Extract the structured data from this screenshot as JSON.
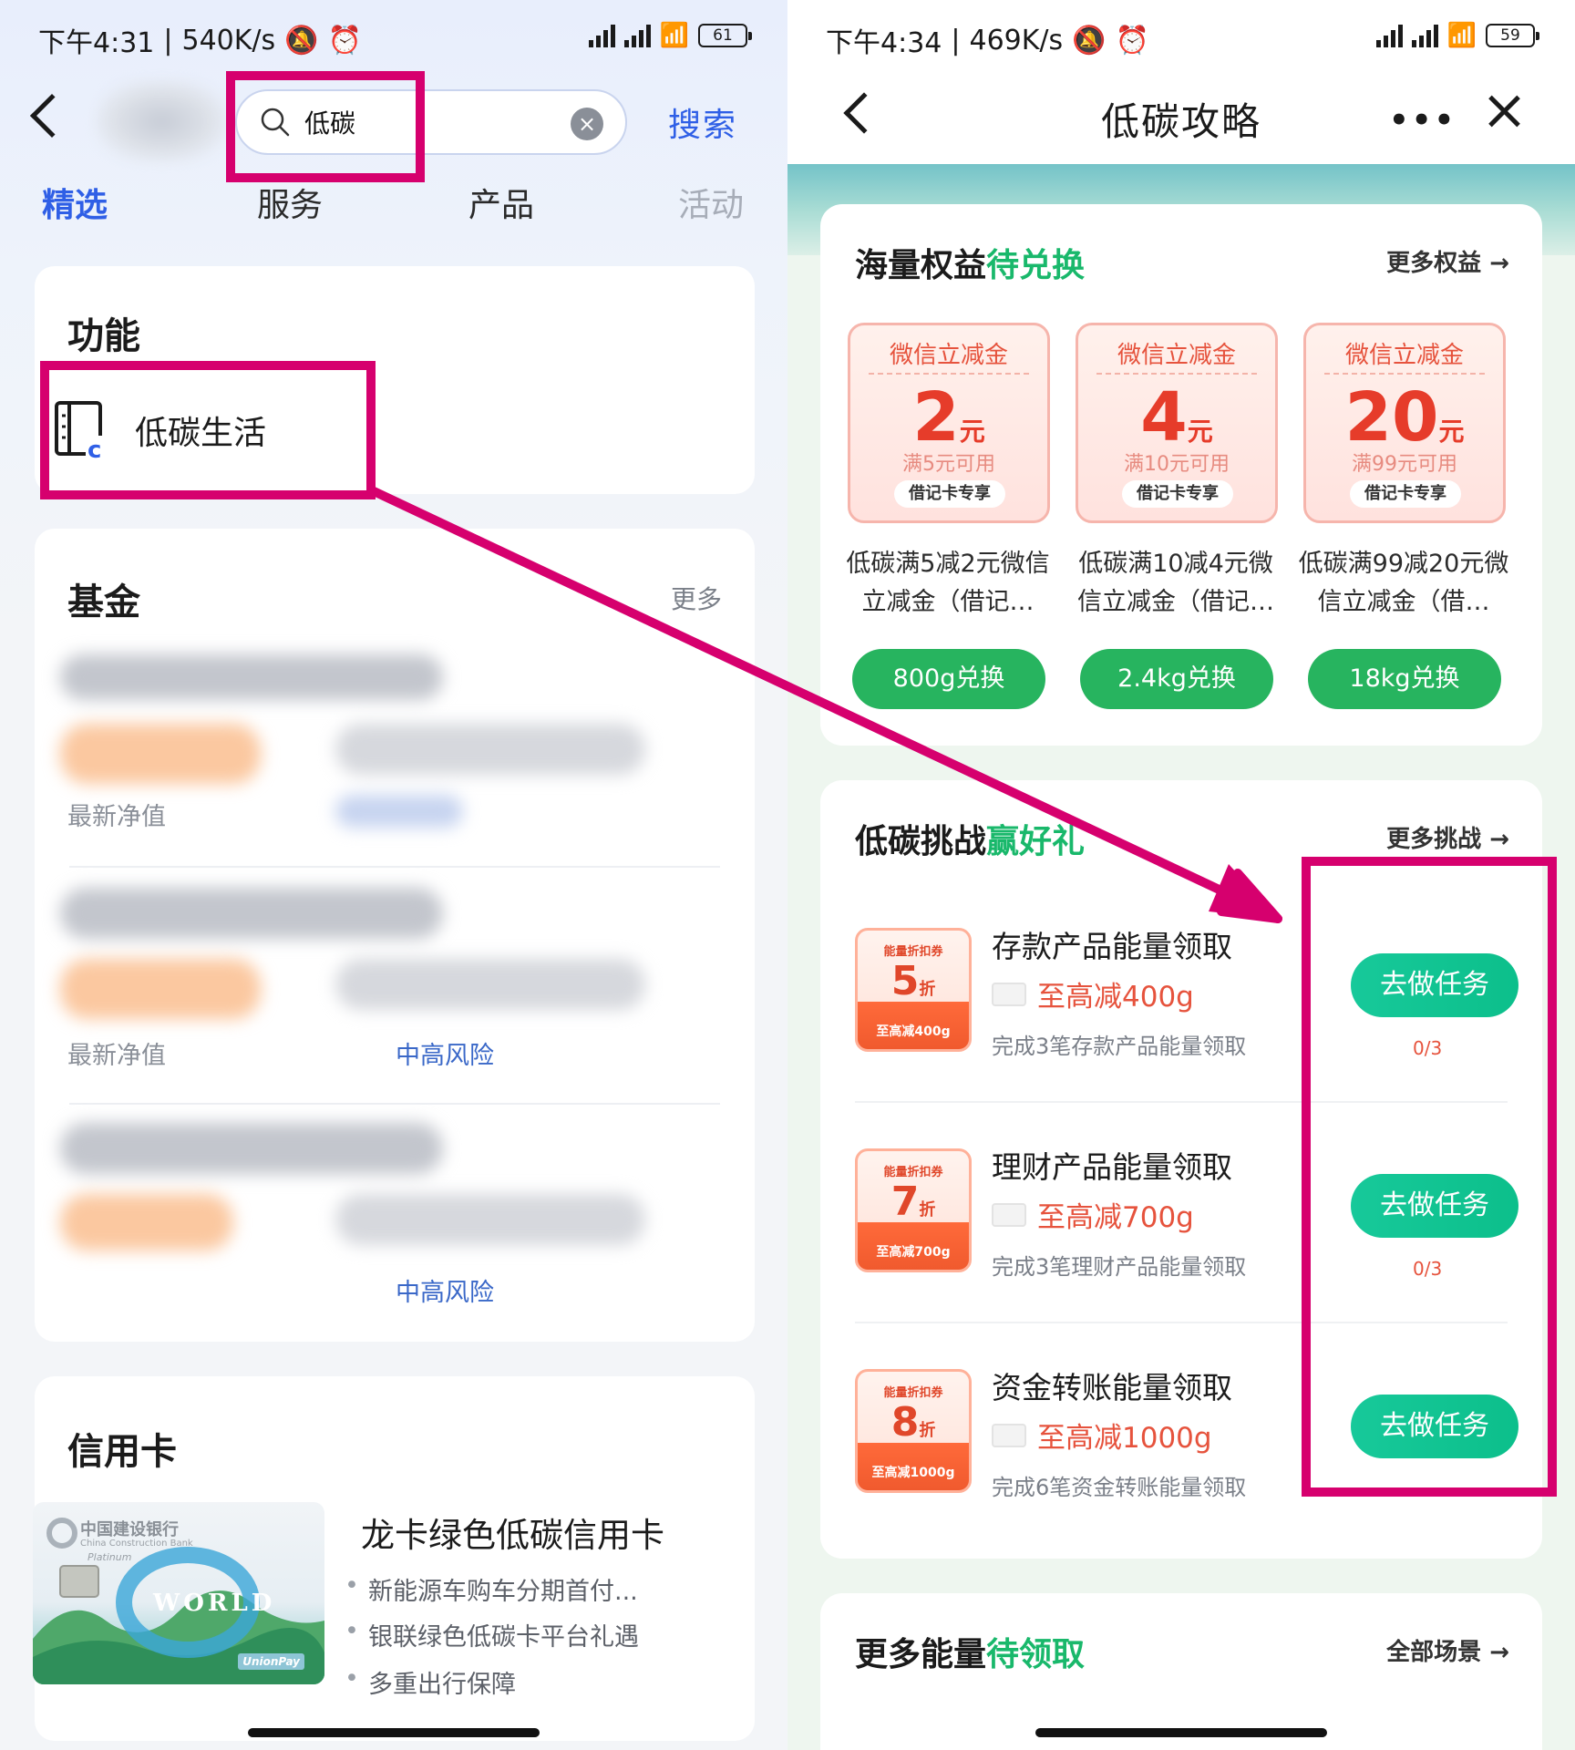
{
  "left": {
    "status": {
      "time": "下午4:31",
      "speed": "540K/s",
      "battery": "61"
    },
    "search": {
      "query": "低碳",
      "button": "搜索"
    },
    "tabs": [
      "精选",
      "服务",
      "产品",
      "活动"
    ],
    "features": {
      "title": "功能",
      "item_label": "低碳生活"
    },
    "funds": {
      "title": "基金",
      "more": "更多",
      "rows": [
        {
          "meta": "最新净值",
          "risk": ""
        },
        {
          "meta": "最新净值",
          "risk": "中高风险"
        },
        {
          "meta": "",
          "risk": "中高风险"
        }
      ]
    },
    "credit_card": {
      "title": "信用卡",
      "product": "龙卡绿色低碳信用卡",
      "bank_name": "中国建设银行",
      "bank_name_en": "China Construction Bank",
      "card_tier": "Platinum",
      "card_world": "WORLD",
      "card_network": "UnionPay",
      "bullets": [
        "新能源车购车分期首付...",
        "银联绿色低碳卡平台礼遇",
        "多重出行保障"
      ]
    }
  },
  "right": {
    "status": {
      "time": "下午4:34",
      "speed": "469K/s",
      "battery": "59"
    },
    "header": {
      "title": "低碳攻略",
      "more": "•••"
    },
    "rewards": {
      "title_main": "海量权益",
      "title_highlight": "待兑换",
      "more": "更多权益 →",
      "coupons": [
        {
          "head": "微信立减金",
          "amount": "2",
          "unit": "元",
          "condition": "满5元可用",
          "tag": "借记卡专享",
          "desc": "低碳满5减2元微信立减金（借记…",
          "button": "800g兑换"
        },
        {
          "head": "微信立减金",
          "amount": "4",
          "unit": "元",
          "condition": "满10元可用",
          "tag": "借记卡专享",
          "desc": "低碳满10减4元微信立减金（借记…",
          "button": "2.4kg兑换"
        },
        {
          "head": "微信立减金",
          "amount": "20",
          "unit": "元",
          "condition": "满99元可用",
          "tag": "借记卡专享",
          "desc": "低碳满99减20元微信立减金（借…",
          "button": "18kg兑换"
        }
      ]
    },
    "challenges": {
      "title_main": "低碳挑战",
      "title_highlight": "赢好礼",
      "more": "更多挑战 →",
      "tasks": [
        {
          "badge": "能量折扣券",
          "discount": "5",
          "zhe": "折",
          "cap": "至高减400g",
          "title": "存款产品能量领取",
          "sub": "至高减400g",
          "desc": "完成3笔存款产品能量领取",
          "button": "去做任务",
          "progress": "0/3"
        },
        {
          "badge": "能量折扣券",
          "discount": "7",
          "zhe": "折",
          "cap": "至高减700g",
          "title": "理财产品能量领取",
          "sub": "至高减700g",
          "desc": "完成3笔理财产品能量领取",
          "button": "去做任务",
          "progress": "0/3"
        },
        {
          "badge": "能量折扣券",
          "discount": "8",
          "zhe": "折",
          "cap": "至高减1000g",
          "title": "资金转账能量领取",
          "sub": "至高减1000g",
          "desc": "完成6笔资金转账能量领取",
          "button": "去做任务",
          "progress": ""
        }
      ]
    },
    "more_energy": {
      "title_main": "更多能量",
      "title_highlight": "待领取",
      "more": "全部场景 →"
    }
  },
  "colors": {
    "annotation": "#d6006e",
    "accent_blue": "#2f5fe6",
    "accent_green": "#19b86b",
    "button_green": "#27b45f",
    "coupon_red": "#e63c2a"
  }
}
